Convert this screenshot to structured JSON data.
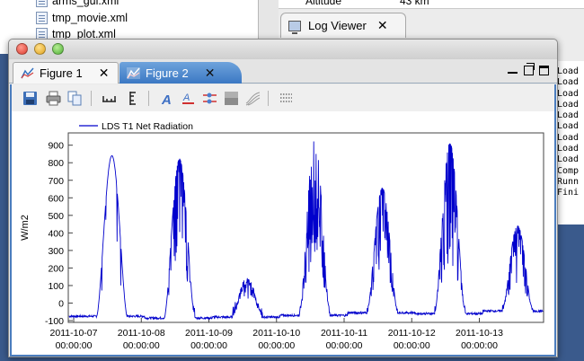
{
  "background": {
    "files": [
      "arms_gui.xml",
      "tmp_movie.xml",
      "tmp_plot.xml"
    ],
    "altitude_label": "Altitude",
    "altitude_value": "43 km",
    "log_tab_label": "Log Viewer",
    "log_tab_close": "✕",
    "log_lines": [
      "Load",
      "Load",
      "Load",
      "Load",
      "Load",
      "Load",
      "Load",
      "Load",
      "Load",
      "Comp",
      "Runn",
      "Fini"
    ]
  },
  "window": {
    "tabs": [
      {
        "label": "Figure 1",
        "close": "✕",
        "active": false
      },
      {
        "label": "Figure 2",
        "close": "✕",
        "active": true
      }
    ]
  },
  "toolbar": {
    "icons": [
      "save-icon",
      "print-icon",
      "copy-icon",
      "x-axis-range-icon",
      "y-axis-range-icon",
      "font-icon",
      "text-color-icon",
      "line-style-icon",
      "background-icon",
      "smoothing-icon",
      "grid-icon"
    ]
  },
  "colors": {
    "series": "#0000cc",
    "active_tab": "#4a86cf",
    "frame": "#4b7dbe"
  },
  "chart_data": {
    "type": "line",
    "ylabel": "W/m2",
    "xlabel": "",
    "ylim": [
      -110,
      970
    ],
    "yticks": [
      -100,
      0,
      100,
      200,
      300,
      400,
      500,
      600,
      700,
      800,
      900
    ],
    "xticks": [
      {
        "line1": "2011-10-07",
        "line2": "00:00:00",
        "day": 0
      },
      {
        "line1": "2011-10-08",
        "line2": "00:00:00",
        "day": 1
      },
      {
        "line1": "2011-10-09",
        "line2": "00:00:00",
        "day": 2
      },
      {
        "line1": "2011-10-10",
        "line2": "00:00:00",
        "day": 3
      },
      {
        "line1": "2011-10-11",
        "line2": "00:00:00",
        "day": 4
      },
      {
        "line1": "2011-10-12",
        "line2": "00:00:00",
        "day": 5
      },
      {
        "line1": "2011-10-13",
        "line2": "00:00:00",
        "day": 6
      }
    ],
    "xlim_days": [
      -0.08,
      6.95
    ],
    "grid": false,
    "legend_position": "top-left",
    "series": [
      {
        "name": "LDS T1 Net Radiation",
        "color": "#0000cc",
        "day_profiles": [
          {
            "day": 0,
            "peak": 840,
            "night": -75,
            "spikes": 0.05
          },
          {
            "day": 1,
            "peak": 820,
            "night": -85,
            "spikes": 0.35
          },
          {
            "day": 2,
            "peak": 120,
            "night": -80,
            "spikes": 0.4
          },
          {
            "day": 3,
            "peak": 930,
            "night": -70,
            "spikes": 0.8
          },
          {
            "day": 4,
            "peak": 655,
            "night": -55,
            "spikes": 0.55
          },
          {
            "day": 5,
            "peak": 910,
            "night": -60,
            "spikes": 0.6
          },
          {
            "day": 6,
            "peak": 440,
            "night": -45,
            "spikes": 0.6
          }
        ]
      }
    ]
  }
}
